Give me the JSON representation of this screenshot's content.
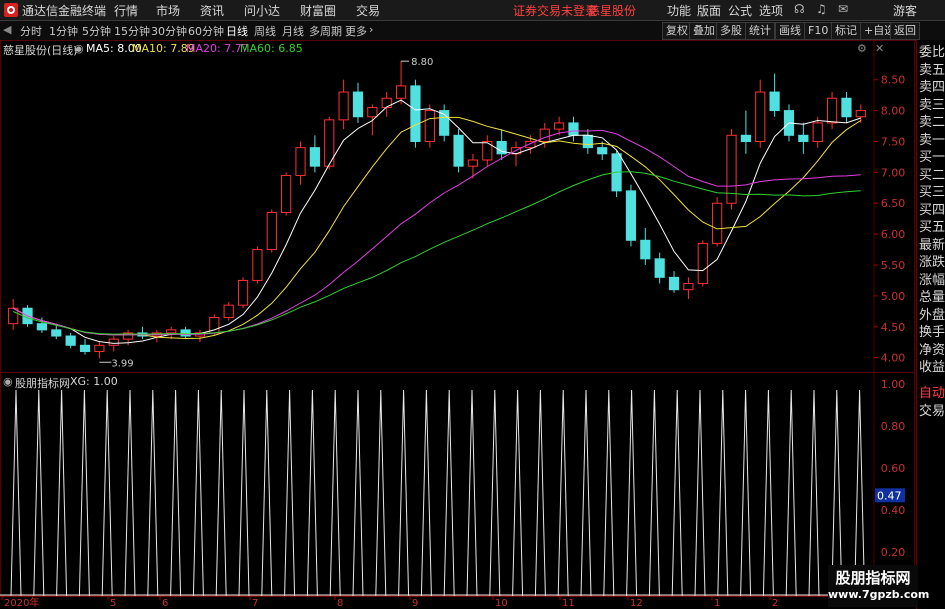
{
  "app": {
    "title": "通达信金融终端",
    "menu": [
      "行情",
      "市场",
      "资讯",
      "问小达",
      "财富圈",
      "交易"
    ],
    "notice": "证券交易未登录",
    "stock_link": "慈星股份",
    "right_menu": [
      "功能",
      "版面",
      "公式",
      "选项"
    ],
    "user": "游客"
  },
  "periods": [
    "分时",
    "1分钟",
    "5分钟",
    "15分钟",
    "30分钟",
    "60分钟",
    "日线",
    "周线",
    "月线",
    "多周期",
    "更多"
  ],
  "active_period": "日线",
  "toolbar_right": [
    "复权",
    "叠加",
    "多股",
    "统计",
    "画线",
    "F10",
    "标记",
    "+自选",
    "返回"
  ],
  "main_panel": {
    "stock_title": "慈星股份(日线)",
    "ma": [
      {
        "label": "MA5: 8.00",
        "color": "#ffffff"
      },
      {
        "label": "MA10: 7.89",
        "color": "#f0e040"
      },
      {
        "label": "MA20: 7.77",
        "color": "#e040e0"
      },
      {
        "label": "MA60: 6.85",
        "color": "#30d030"
      }
    ],
    "high_label": "8.80",
    "low_label": "3.99",
    "y_ticks": [
      "8.50",
      "8.00",
      "7.50",
      "7.00",
      "6.50",
      "6.00",
      "5.50",
      "5.00",
      "4.50",
      "4.00"
    ],
    "y_range": [
      3.8,
      8.9
    ]
  },
  "sub_panel": {
    "title": "股朋指标网",
    "value_label": "XG: 1.00",
    "y_ticks": [
      "1.00",
      "0.80",
      "0.60",
      "0.40",
      "0.20"
    ],
    "cursor_value": "0.47"
  },
  "x_labels": [
    "2020年",
    "5",
    "6",
    "7",
    "8",
    "9",
    "10",
    "11",
    "12",
    "1",
    "2"
  ],
  "side_panel": [
    "委比",
    "卖五",
    "卖四",
    "卖三",
    "卖二",
    "卖一",
    "买一",
    "买二",
    "买三",
    "买四",
    "买五",
    "最新",
    "涨跌",
    "涨幅",
    "总量",
    "外盘",
    "换手",
    "净资",
    "收益"
  ],
  "side_bottom": [
    "自动",
    "交易"
  ],
  "watermark": {
    "line1": "股朋指标网",
    "line2": "www.7gpzb.com"
  },
  "colors": {
    "up": "#ff3030",
    "down": "#50e0e0",
    "ma5": "#ffffff",
    "ma10": "#f0e040",
    "ma20": "#e040e0",
    "ma60": "#30d030",
    "grid": "#5a0000"
  },
  "chart_data": {
    "type": "candlestick",
    "title": "慈星股份(日线)",
    "price_ohlc_approx": [
      [
        4.55,
        4.95,
        4.45,
        4.8
      ],
      [
        4.8,
        4.85,
        4.5,
        4.55
      ],
      [
        4.55,
        4.65,
        4.4,
        4.45
      ],
      [
        4.45,
        4.55,
        4.3,
        4.35
      ],
      [
        4.35,
        4.4,
        4.15,
        4.2
      ],
      [
        4.2,
        4.3,
        4.05,
        4.1
      ],
      [
        4.1,
        4.25,
        3.99,
        4.2
      ],
      [
        4.2,
        4.35,
        4.1,
        4.3
      ],
      [
        4.3,
        4.45,
        4.2,
        4.4
      ],
      [
        4.4,
        4.5,
        4.3,
        4.35
      ],
      [
        4.35,
        4.45,
        4.25,
        4.4
      ],
      [
        4.4,
        4.5,
        4.3,
        4.45
      ],
      [
        4.45,
        4.5,
        4.3,
        4.35
      ],
      [
        4.35,
        4.45,
        4.25,
        4.4
      ],
      [
        4.4,
        4.7,
        4.35,
        4.65
      ],
      [
        4.65,
        4.9,
        4.6,
        4.85
      ],
      [
        4.85,
        5.3,
        4.8,
        5.25
      ],
      [
        5.25,
        5.8,
        5.2,
        5.75
      ],
      [
        5.75,
        6.4,
        5.7,
        6.35
      ],
      [
        6.35,
        7.0,
        6.3,
        6.95
      ],
      [
        6.95,
        7.5,
        6.8,
        7.4
      ],
      [
        7.4,
        7.6,
        7.0,
        7.1
      ],
      [
        7.1,
        7.9,
        7.05,
        7.85
      ],
      [
        7.85,
        8.5,
        7.7,
        8.3
      ],
      [
        8.3,
        8.45,
        7.8,
        7.9
      ],
      [
        7.9,
        8.1,
        7.6,
        8.05
      ],
      [
        8.05,
        8.3,
        7.9,
        8.2
      ],
      [
        8.2,
        8.8,
        8.1,
        8.4
      ],
      [
        8.4,
        8.5,
        7.4,
        7.5
      ],
      [
        7.5,
        8.1,
        7.4,
        8.0
      ],
      [
        8.0,
        8.1,
        7.5,
        7.6
      ],
      [
        7.6,
        7.7,
        7.0,
        7.1
      ],
      [
        7.1,
        7.3,
        6.9,
        7.2
      ],
      [
        7.2,
        7.6,
        7.1,
        7.5
      ],
      [
        7.5,
        7.7,
        7.2,
        7.3
      ],
      [
        7.3,
        7.5,
        7.1,
        7.4
      ],
      [
        7.4,
        7.6,
        7.3,
        7.5
      ],
      [
        7.5,
        7.8,
        7.4,
        7.7
      ],
      [
        7.7,
        7.9,
        7.6,
        7.8
      ],
      [
        7.8,
        7.9,
        7.5,
        7.6
      ],
      [
        7.6,
        7.7,
        7.3,
        7.4
      ],
      [
        7.4,
        7.5,
        7.2,
        7.3
      ],
      [
        7.3,
        7.35,
        6.6,
        6.7
      ],
      [
        6.7,
        6.8,
        5.8,
        5.9
      ],
      [
        5.9,
        6.1,
        5.5,
        5.6
      ],
      [
        5.6,
        5.7,
        5.2,
        5.3
      ],
      [
        5.3,
        5.4,
        5.05,
        5.1
      ],
      [
        5.1,
        5.3,
        4.95,
        5.2
      ],
      [
        5.2,
        5.9,
        5.15,
        5.85
      ],
      [
        5.85,
        6.6,
        5.8,
        6.5
      ],
      [
        6.5,
        7.7,
        6.4,
        7.6
      ],
      [
        7.6,
        8.0,
        7.3,
        7.5
      ],
      [
        7.5,
        8.5,
        7.4,
        8.3
      ],
      [
        8.3,
        8.6,
        7.9,
        8.0
      ],
      [
        8.0,
        8.1,
        7.5,
        7.6
      ],
      [
        7.6,
        7.8,
        7.3,
        7.5
      ],
      [
        7.5,
        7.9,
        7.4,
        7.8
      ],
      [
        7.8,
        8.3,
        7.7,
        8.2
      ],
      [
        8.2,
        8.3,
        7.8,
        7.9
      ],
      [
        7.9,
        8.1,
        7.8,
        8.0
      ]
    ],
    "xg_signal": "periodic spikes to 1.00, baseline 0"
  }
}
